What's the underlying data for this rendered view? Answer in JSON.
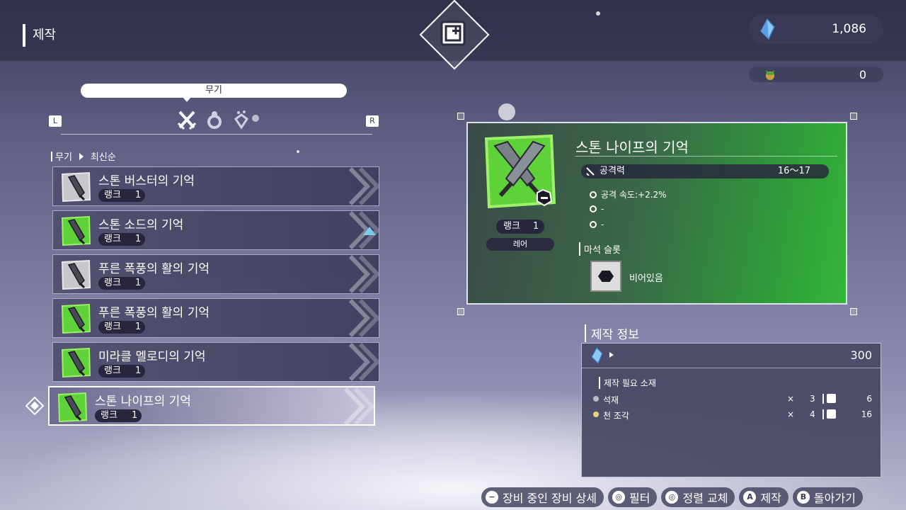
{
  "header": {
    "title": "제작",
    "currency_value": "1,086",
    "currency2_value": "0"
  },
  "category": {
    "current": "무기",
    "left_button": "L",
    "right_button": "R",
    "tabs": [
      "sword-icon",
      "ring-icon",
      "material-icon"
    ]
  },
  "breadcrumb": {
    "category": "무기",
    "sort": "최신순"
  },
  "items": [
    {
      "name": "스톤 버스터의 기억",
      "rank_label": "랭크",
      "rank": "1",
      "thumb": "gray"
    },
    {
      "name": "스톤 소드의 기억",
      "rank_label": "랭크",
      "rank": "1",
      "thumb": "green"
    },
    {
      "name": "푸른 폭풍의 활의 기억",
      "rank_label": "랭크",
      "rank": "1",
      "thumb": "gray"
    },
    {
      "name": "푸른 폭풍의 활의 기억",
      "rank_label": "랭크",
      "rank": "1",
      "thumb": "green"
    },
    {
      "name": "미라클 멜로디의 기억",
      "rank_label": "랭크",
      "rank": "1",
      "thumb": "green"
    },
    {
      "name": "스톤 나이프의 기억",
      "rank_label": "랭크",
      "rank": "1",
      "thumb": "green"
    }
  ],
  "detail": {
    "title": "스톤 나이프의 기억",
    "rank_label": "랭크",
    "rank": "1",
    "rarity": "레어",
    "attack_label": "공격력",
    "attack_value": "16〜17",
    "stats": [
      "공격 속도:+2.2%",
      "-",
      "-"
    ],
    "slot_heading": "마석 슬롯",
    "slot_text": "비어있음"
  },
  "craft": {
    "heading": "제작 정보",
    "cost": "300",
    "materials_heading": "제작 필요 소재",
    "materials": [
      {
        "name": "석재",
        "x": "×",
        "required": "3",
        "owned": "6"
      },
      {
        "name": "천 조각",
        "x": "×",
        "required": "4",
        "owned": "16"
      }
    ]
  },
  "buttons": [
    {
      "key": "−",
      "label": "장비 중인 장비 상세"
    },
    {
      "key": "◎",
      "label": "필터"
    },
    {
      "key": "◎",
      "label": "정렬 교체"
    },
    {
      "key": "A",
      "label": "제작"
    },
    {
      "key": "B",
      "label": "돌아가기"
    }
  ],
  "colors": {
    "accent_green": "#4fc23a",
    "panel": "#4a486a",
    "scroll_arrow": "#7ec8e8"
  }
}
